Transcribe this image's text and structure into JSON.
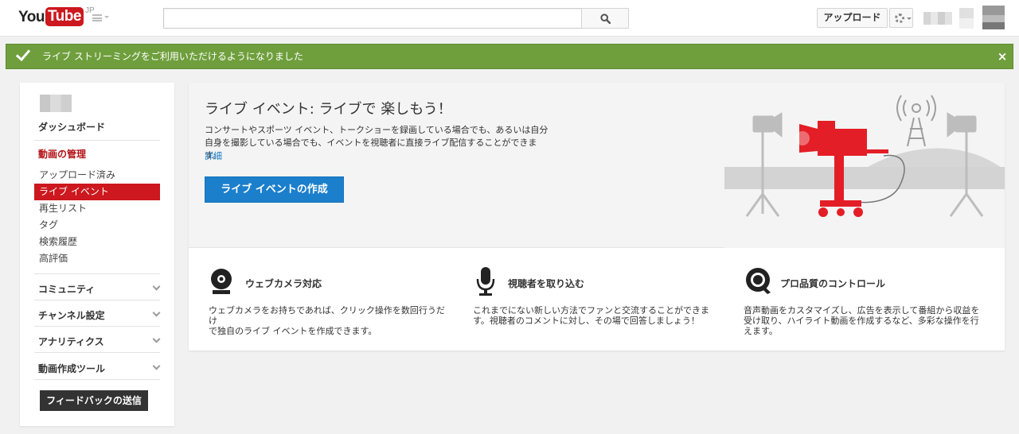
{
  "header": {
    "logo_you": "You",
    "logo_tube": "Tube",
    "logo_region": "JP",
    "search_placeholder": "",
    "upload_label": "アップロード"
  },
  "alert": {
    "message": "ライブ ストリーミングをご利用いただけるようになりました",
    "close": "×"
  },
  "sidebar": {
    "dashboard": "ダッシュボード",
    "manage_heading": "動画の管理",
    "items": [
      {
        "label": "アップロード済み"
      },
      {
        "label": "ライブ イベント"
      },
      {
        "label": "再生リスト"
      },
      {
        "label": "タグ"
      },
      {
        "label": "検索履歴"
      },
      {
        "label": "高評価"
      }
    ],
    "sections": [
      {
        "label": "コミュニティ"
      },
      {
        "label": "チャンネル設定"
      },
      {
        "label": "アナリティクス"
      },
      {
        "label": "動画作成ツール"
      }
    ],
    "feedback": "フィードバックの送信"
  },
  "main": {
    "title": "ライブ イベント: ライブで 楽しもう！",
    "desc": "コンサートやスポーツ イベント、トークショーを録画している場合でも、あるいは自分自身を撮影している場合でも、イベントを視聴者に直接ライブ配信することができます。",
    "link": "詳細",
    "create_button": "ライブ イベントの作成",
    "features": [
      {
        "icon": "webcam-icon",
        "title": "ウェブカメラ対応",
        "desc_lines": [
          "ウェブカメラをお持ちであれば、クリック操作を数回行うだけ",
          "で独自のライブ イベントを作成できます。"
        ]
      },
      {
        "icon": "microphone-icon",
        "title": "視聴者を取り込む",
        "desc_lines": [
          "これまでにない新しい方法でファンと交流することができま",
          "す。視聴者のコメントに対し、その場で回答しましょう！"
        ]
      },
      {
        "icon": "quality-control-icon",
        "title": "プロ品質のコントロール",
        "desc_lines": [
          "音声動画をカスタマイズし、広告を表示して番組から収益を",
          "受け取り、ハイライト動画を作成するなど、多彩な操作を行",
          "えます。"
        ]
      }
    ]
  },
  "colors": {
    "brand_red": "#cc181e",
    "alert_green": "#6f9f3d",
    "button_blue": "#1b7fcc"
  }
}
